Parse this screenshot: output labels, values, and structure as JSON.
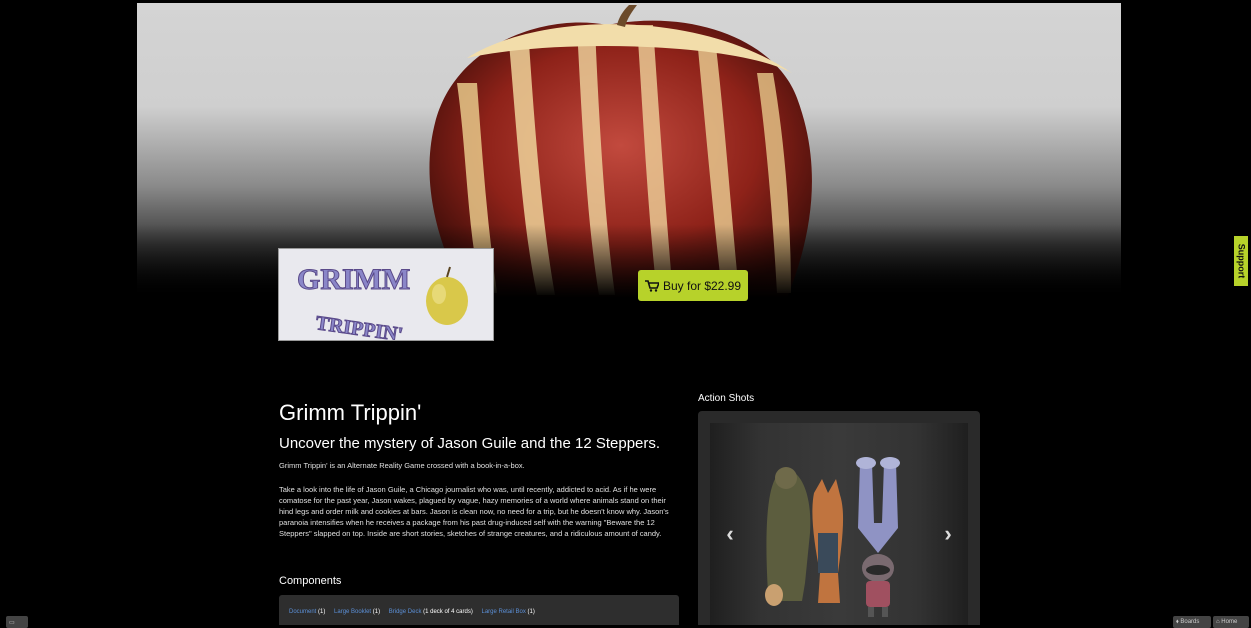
{
  "banner": {
    "image_alt_icon": "apple-banner-icon"
  },
  "logo": {
    "icon": "grimm-trippin-logo",
    "text": "GRIMM TRIPPIN'"
  },
  "buy": {
    "label": "Buy for $22.99",
    "icon": "cart-icon",
    "color": "#b7d22a"
  },
  "support": {
    "label": "Support"
  },
  "game": {
    "title": "Grimm Trippin'",
    "tagline": "Uncover the mystery of Jason Guile and the 12 Steppers.",
    "short_description": "Grimm Trippin' is an Alternate Reality Game crossed with a book-in-a-box.",
    "long_description": "Take a look into the life of Jason Guile, a Chicago journalist who was, until recently, addicted to acid. As if he were comatose for the past year, Jason wakes, plagued by vague, hazy memories of a world where animals stand on their hind legs and order milk and cookies at bars. Jason is clean now, no need for a trip, but he doesn't know why. Jason's paranoia intensifies when he receives a package from his past drug-induced self with the warning \"Beware the 12 Steppers\" slapped on top. Inside are short stories, sketches of strange creatures, and a ridiculous amount of candy."
  },
  "components": {
    "heading": "Components",
    "items": [
      {
        "name": "Document",
        "count": "(1)"
      },
      {
        "name": "Large Booklet",
        "count": "(1)"
      },
      {
        "name": "Bridge Deck",
        "count": "(1 deck of 4 cards)"
      },
      {
        "name": "Large Retail Box",
        "count": "(1)"
      }
    ]
  },
  "action_shots": {
    "heading": "Action Shots",
    "prev_icon": "chevron-left-icon",
    "next_icon": "chevron-right-icon"
  },
  "footer": {
    "left_icon": "chat-icon",
    "right_buttons": [
      {
        "label": "Boards",
        "icon": "pin-icon"
      },
      {
        "label": "Home",
        "icon": "home-icon"
      }
    ]
  }
}
